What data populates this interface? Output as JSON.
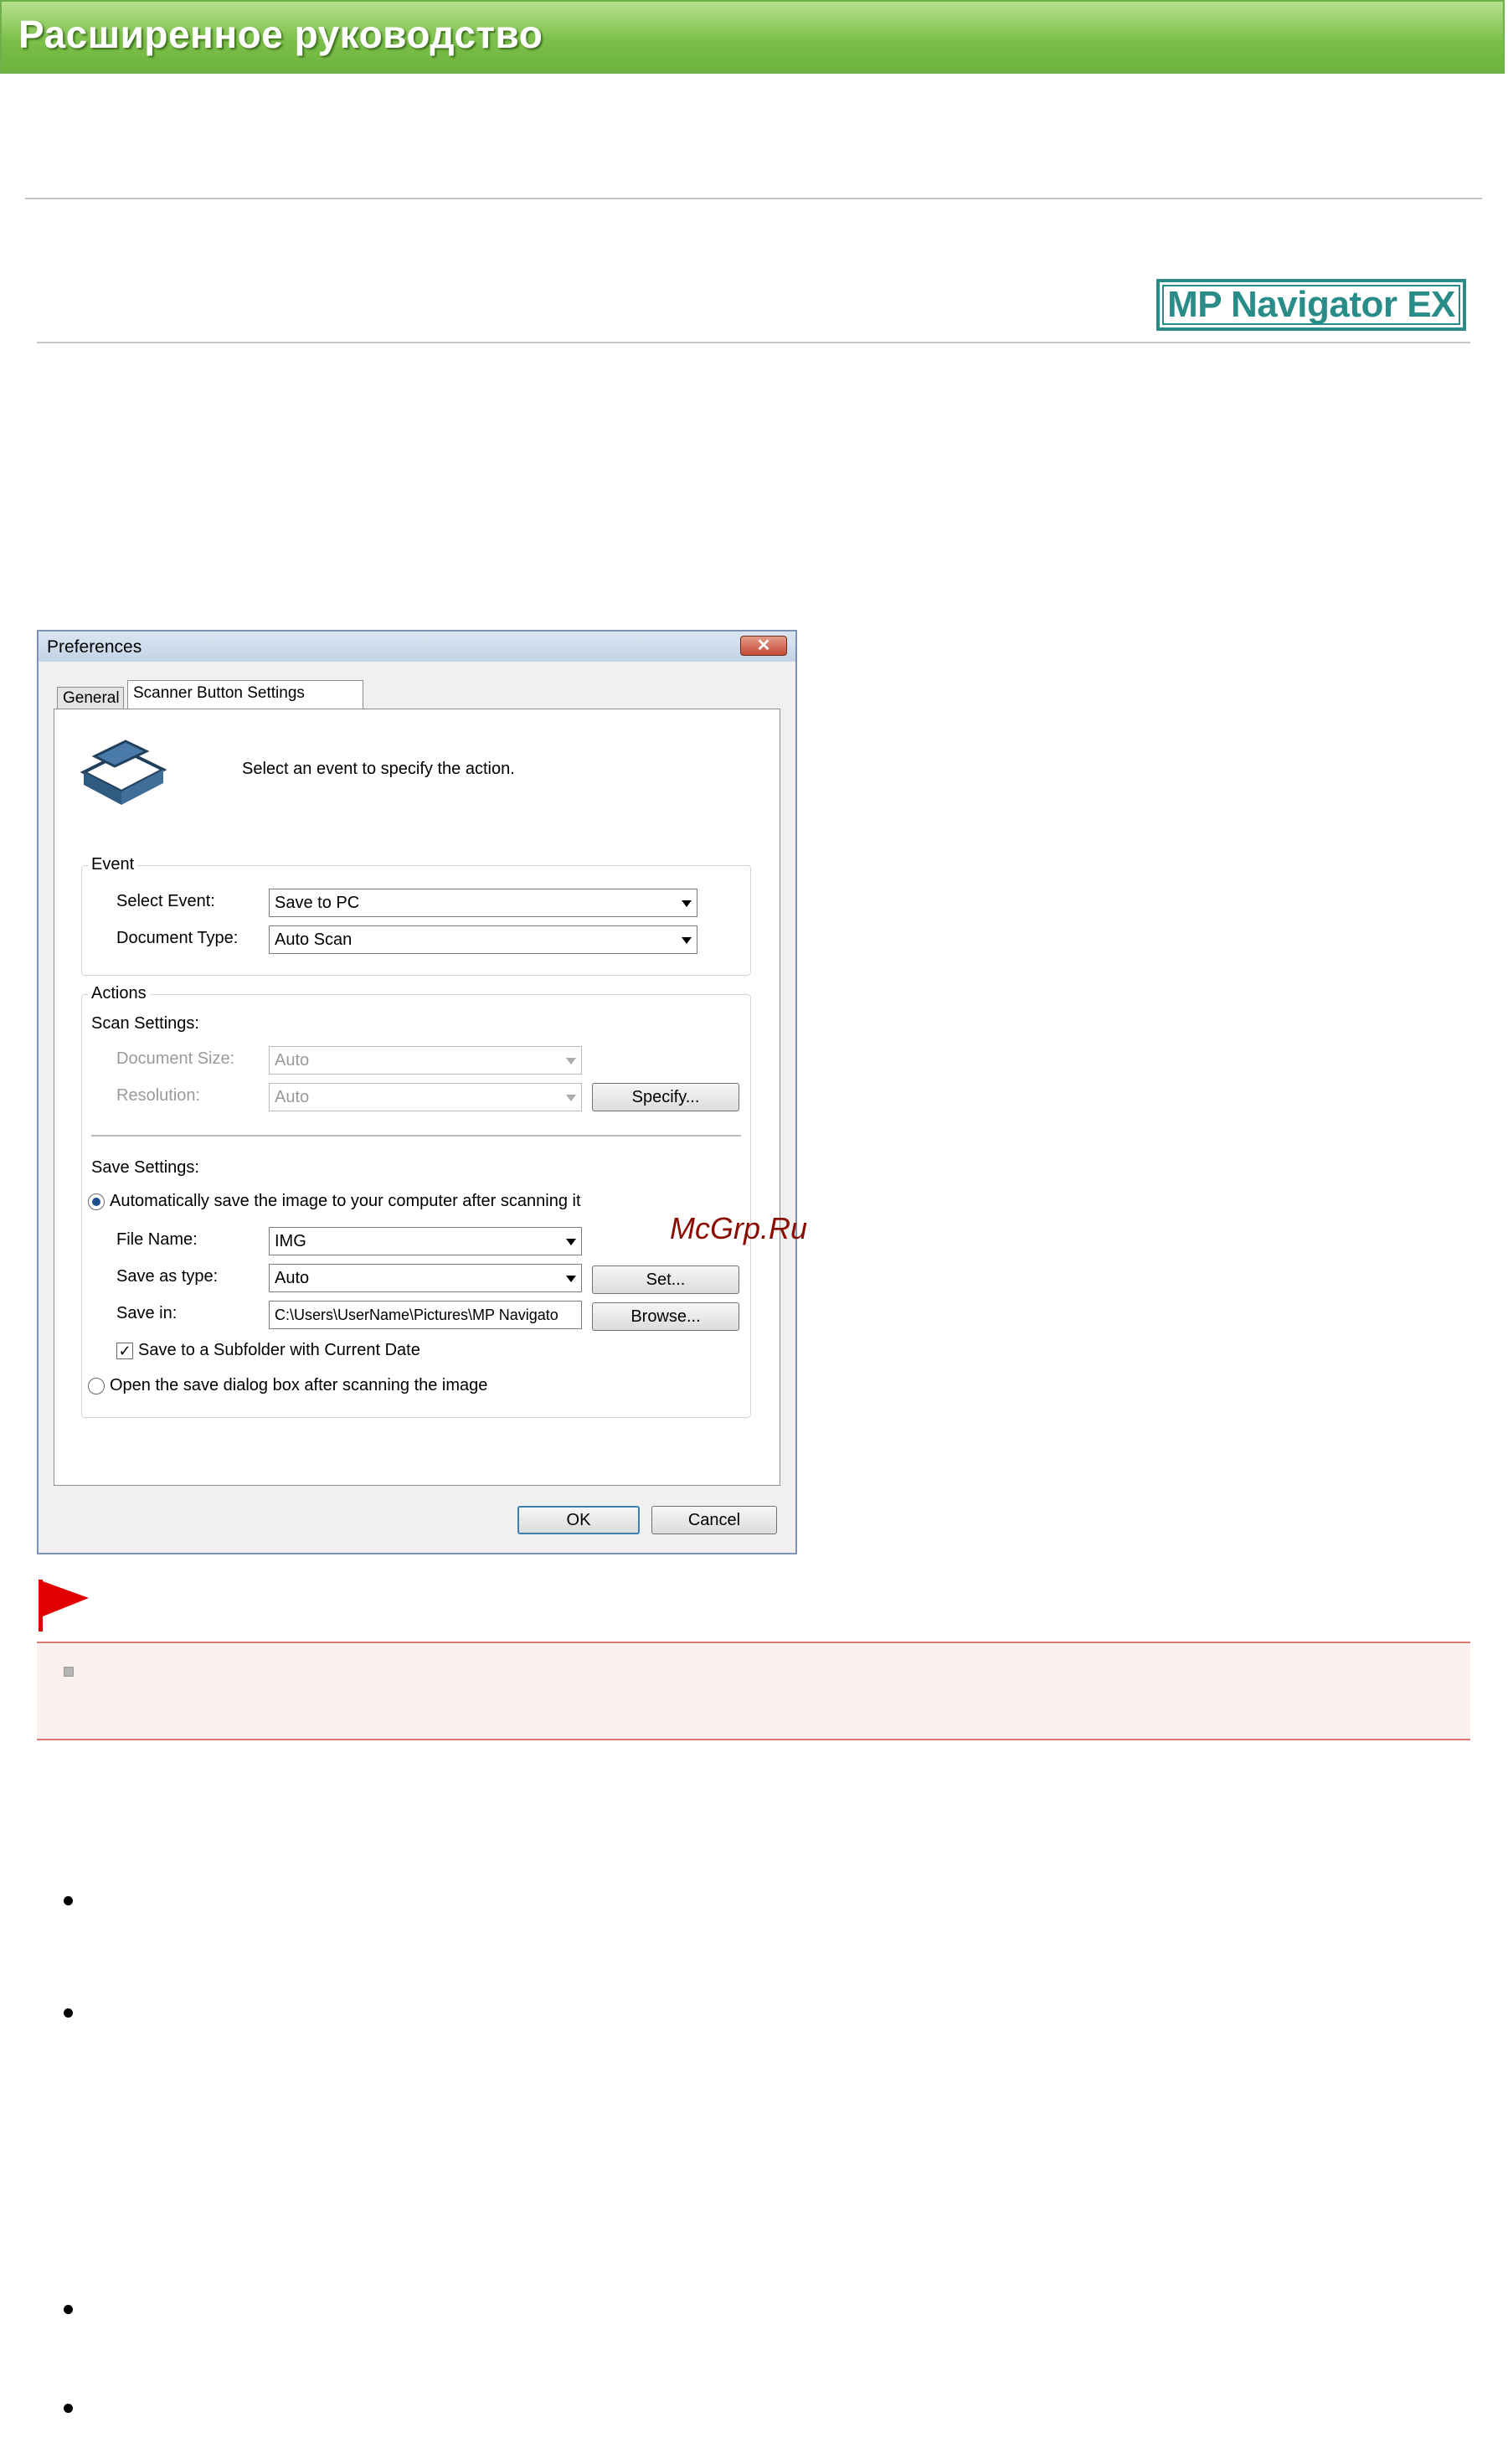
{
  "header": {
    "title": "Расширенное руководство"
  },
  "logo": {
    "text": "MP Navigator EX",
    "color": "#2a8c88"
  },
  "dialog": {
    "title": "Preferences",
    "close_label": "✕",
    "tabs": [
      {
        "label": "General"
      },
      {
        "label": "Scanner Button Settings"
      }
    ],
    "intro": "Select an event to specify the action.",
    "event_group": {
      "label": "Event",
      "select_event_label": "Select Event:",
      "select_event_value": "Save to PC",
      "document_type_label": "Document Type:",
      "document_type_value": "Auto Scan"
    },
    "actions_group": {
      "label": "Actions",
      "scan_settings_label": "Scan Settings:",
      "document_size_label": "Document Size:",
      "document_size_value": "Auto",
      "resolution_label": "Resolution:",
      "resolution_value": "Auto",
      "specify_button": "Specify...",
      "save_settings_label": "Save Settings:",
      "auto_save_label": "Automatically save the image to your computer after scanning it",
      "file_name_label": "File Name:",
      "file_name_value": "IMG",
      "save_as_type_label": "Save as type:",
      "save_as_type_value": "Auto",
      "set_button": "Set...",
      "save_in_label": "Save in:",
      "save_in_value": "C:\\Users\\UserName\\Pictures\\MP Navigato",
      "browse_button": "Browse...",
      "subfolder_label": "Save to a Subfolder with Current Date",
      "open_dialog_label": "Open the save dialog box after scanning the image"
    },
    "ok_button": "OK",
    "cancel_button": "Cancel"
  },
  "watermark": "McGrp.Ru",
  "colors": {
    "banner_green": "#7cc04a",
    "important_red": "#e00000",
    "important_bg": "#fdf1f0"
  }
}
